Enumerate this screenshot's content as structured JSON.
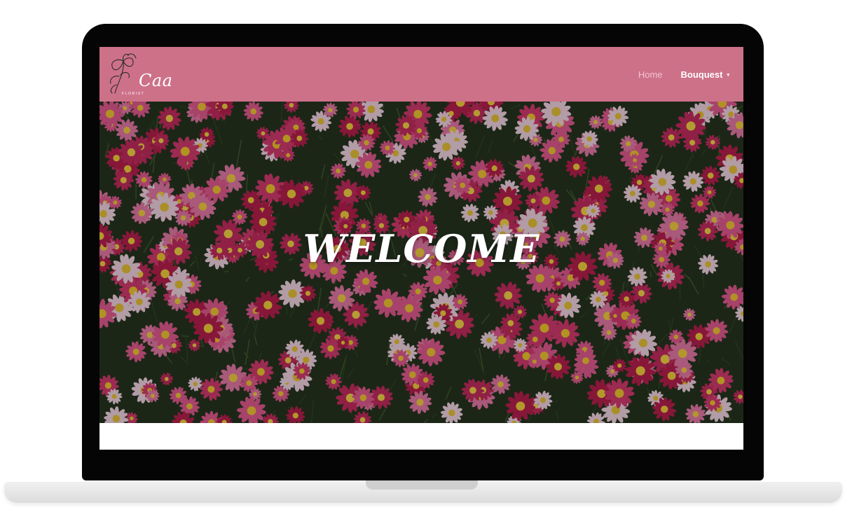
{
  "brand": {
    "script": "Caa",
    "subtitle": "FLORIST"
  },
  "nav": {
    "home_label": "Home",
    "bouquest_label": "Bouquest",
    "caret": "▾"
  },
  "hero": {
    "title": "WELCOME"
  },
  "colors": {
    "navbar": "#cd7189",
    "hero_overlay": "rgba(10,8,10,0.28)",
    "laptop_frame": "#050505"
  }
}
